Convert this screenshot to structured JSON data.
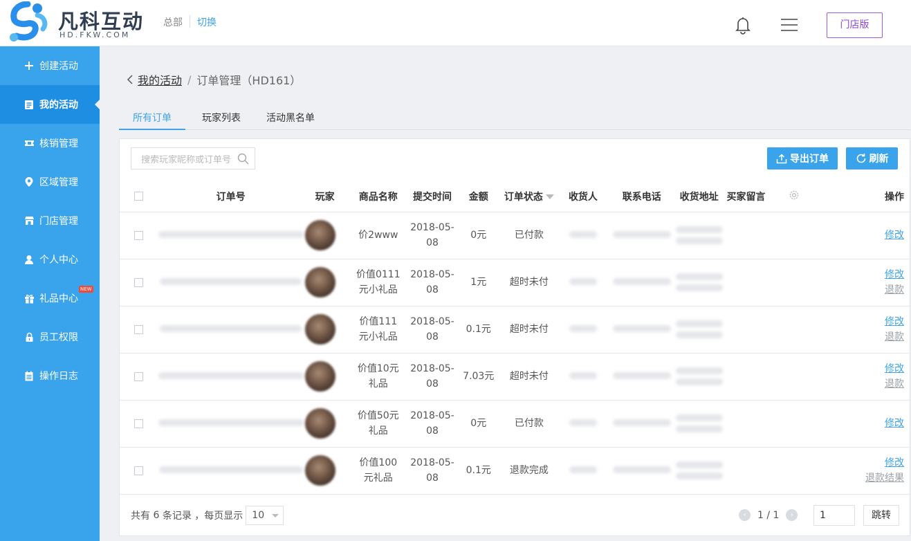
{
  "header": {
    "logo_text": "凡科互动",
    "logo_sub": "HD.FKW.COM",
    "hq_label": "总部",
    "switch_label": "切换",
    "store_button": "门店版",
    "brand_color": "#39a3ec"
  },
  "sidebar": {
    "items": [
      {
        "label": "创建活动",
        "icon": "plus-icon"
      },
      {
        "label": "我的活动",
        "icon": "document-icon",
        "active": true
      },
      {
        "label": "核销管理",
        "icon": "ticket-icon"
      },
      {
        "label": "区域管理",
        "icon": "location-pin-icon"
      },
      {
        "label": "门店管理",
        "icon": "store-icon"
      },
      {
        "label": "个人中心",
        "icon": "person-icon"
      },
      {
        "label": "礼品中心",
        "icon": "gift-icon",
        "badge": "NEW"
      },
      {
        "label": "员工权限",
        "icon": "lock-icon"
      },
      {
        "label": "操作日志",
        "icon": "log-icon"
      }
    ]
  },
  "breadcrumb": {
    "back": "我的活动",
    "separator": "/",
    "current": "订单管理（HD161）"
  },
  "tabs": [
    "所有订单",
    "玩家列表",
    "活动黑名单"
  ],
  "toolbar": {
    "search_placeholder": "搜索玩家昵称或订单号",
    "export_label": "导出订单",
    "refresh_label": "刷新"
  },
  "table": {
    "columns": [
      "订单号",
      "玩家",
      "商品名称",
      "提交时间",
      "金额",
      "订单状态",
      "收货人",
      "联系电话",
      "收货地址",
      "买家留言",
      "",
      "操作"
    ],
    "rows": [
      {
        "product": [
          "价2www"
        ],
        "time": [
          "2018-05-",
          "08"
        ],
        "amount": "0元",
        "status": "已付款",
        "actions": [
          "修改"
        ]
      },
      {
        "product": [
          "价值0111",
          "元小礼品"
        ],
        "time": [
          "2018-05-",
          "08"
        ],
        "amount": "1元",
        "status": "超时未付",
        "actions": [
          "修改",
          "退款"
        ]
      },
      {
        "product": [
          "价值111",
          "元小礼品"
        ],
        "time": [
          "2018-05-",
          "08"
        ],
        "amount": "0.1元",
        "status": "超时未付",
        "actions": [
          "修改",
          "退款"
        ]
      },
      {
        "product": [
          "价值10元",
          "礼品"
        ],
        "time": [
          "2018-05-",
          "08"
        ],
        "amount": "7.03元",
        "status": "超时未付",
        "actions": [
          "修改",
          "退款"
        ]
      },
      {
        "product": [
          "价值50元",
          "礼品"
        ],
        "time": [
          "2018-05-",
          "08"
        ],
        "amount": "0元",
        "status": "已付款",
        "actions": [
          "修改"
        ]
      },
      {
        "product": [
          "价值100",
          "元礼品"
        ],
        "time": [
          "2018-05-",
          "08"
        ],
        "amount": "0.1元",
        "status": "退款完成",
        "actions": [
          "修改",
          "退款结果"
        ]
      }
    ]
  },
  "footer": {
    "total_prefix": "共有",
    "total_count": "6",
    "total_suffix": "条记录 ，每页显示",
    "page_size": "10",
    "page_indicator": "1 / 1",
    "page_input": "1",
    "jump_label": "跳转"
  }
}
